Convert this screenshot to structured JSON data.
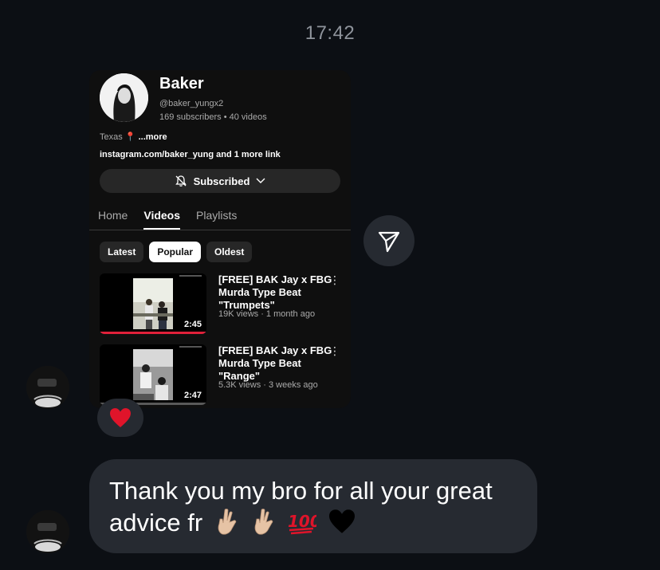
{
  "time": "17:42",
  "channel": {
    "name": "Baker",
    "handle": "@baker_yungx2",
    "stats": "169 subscribers • 40 videos",
    "location": "Texas",
    "more": "...more",
    "links": "instagram.com/baker_yung and 1 more link",
    "subscribed_label": "Subscribed"
  },
  "tabs": [
    "Home",
    "Videos",
    "Playlists"
  ],
  "chips": [
    "Latest",
    "Popular",
    "Oldest"
  ],
  "videos": [
    {
      "title": "[FREE] BAK Jay x FBG Murda Type Beat \"Trumpets\"",
      "meta": "19K views · 1 month ago",
      "duration": "2:45",
      "watched_fraction": 1.0
    },
    {
      "title": "[FREE] BAK Jay x FBG Murda Type Beat \"Range\"",
      "meta": "5.3K views · 3 weeks ago",
      "duration": "2:47",
      "watched_fraction": 0.0
    }
  ],
  "reaction": "❤️",
  "message": {
    "text": "Thank you my bro for all your great advice fr",
    "emojis": [
      "crossed-fingers",
      "crossed-fingers",
      "hundred-points",
      "black-heart"
    ]
  },
  "colors": {
    "background": "#0c0f14",
    "bubble": "#262a31",
    "progress_red": "#e0203a",
    "heart_red": "#e0142a"
  }
}
